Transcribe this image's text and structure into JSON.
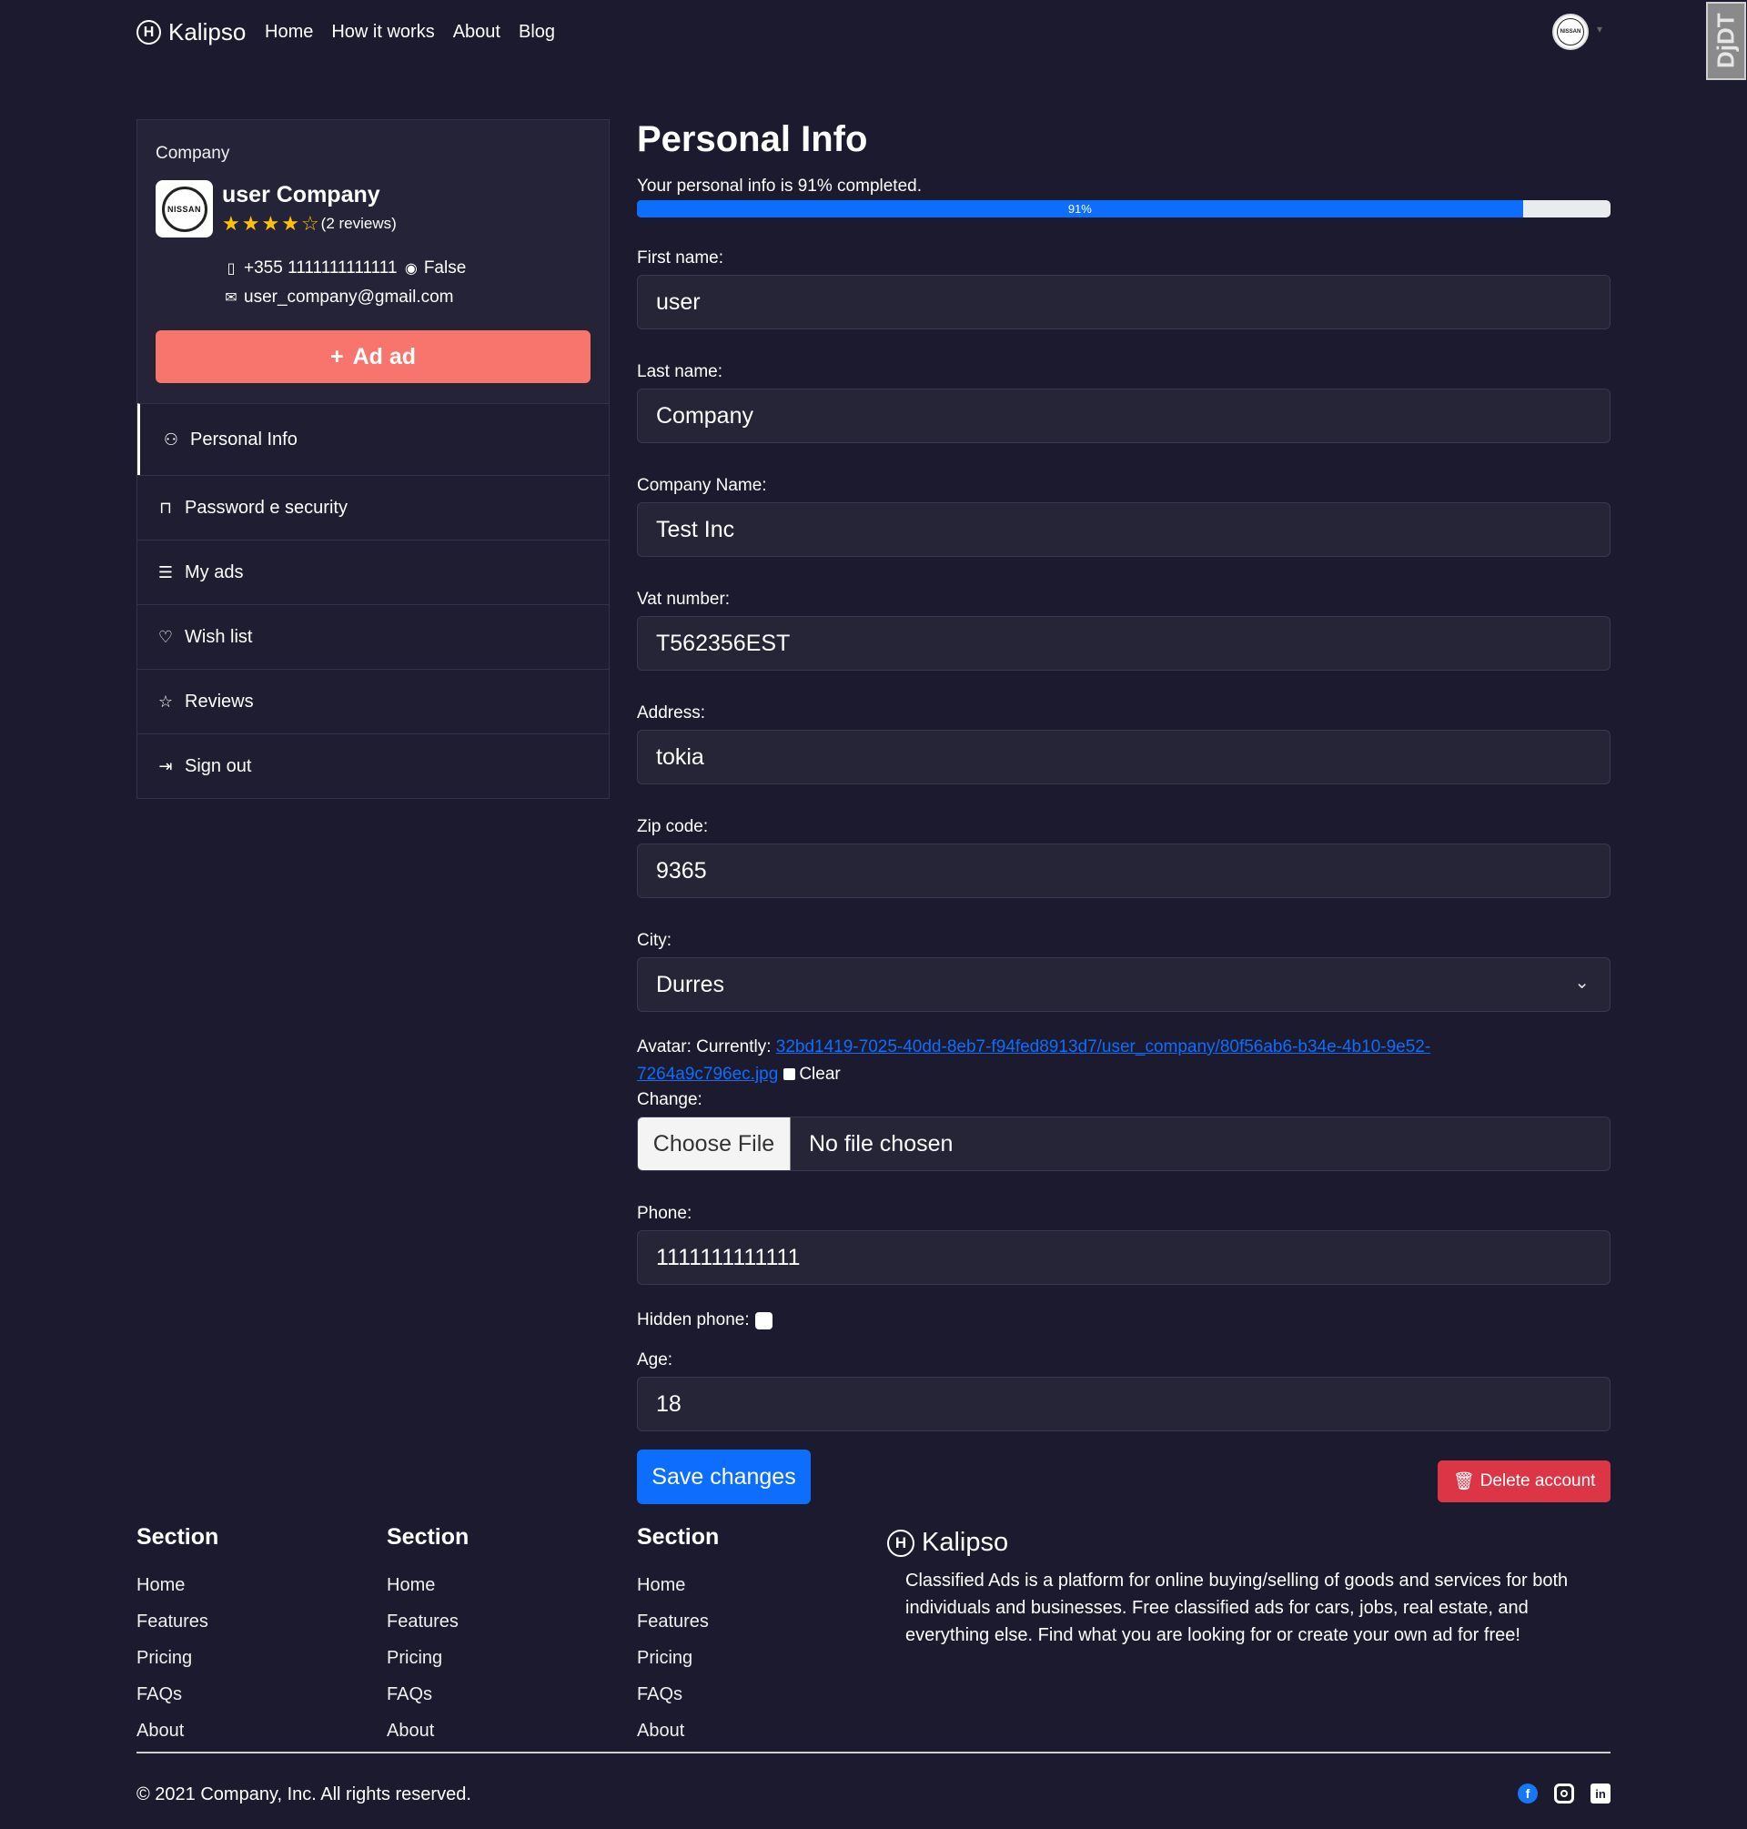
{
  "nav": {
    "brand_glyph": "H",
    "brand": "Kalipso",
    "links": [
      "Home",
      "How it works",
      "About",
      "Blog"
    ],
    "avatar_logo": "NISSAN",
    "corner_badge": "DjDT"
  },
  "sidebar": {
    "role": "Company",
    "logo_text": "NISSAN",
    "company_name": "user Company",
    "rating": 4,
    "rating_max": 5,
    "reviews": "(2 reviews)",
    "phone": "+355 1111111111111",
    "visibility": "False",
    "email": "user_company@gmail.com",
    "add_ad_label": "Ad ad",
    "menu": [
      {
        "label": "Personal Info",
        "icon": "person-icon",
        "active": true
      },
      {
        "label": "Password e security",
        "icon": "lock-icon"
      },
      {
        "label": "My ads",
        "icon": "list-icon"
      },
      {
        "label": "Wish list",
        "icon": "heart-icon"
      },
      {
        "label": "Reviews",
        "icon": "star-icon"
      },
      {
        "label": "Sign out",
        "icon": "sign-out-icon"
      }
    ]
  },
  "main": {
    "title": "Personal Info",
    "progress_text": "Your personal info is 91% completed.",
    "progress_percent": 91,
    "progress_label": "91%",
    "fields": {
      "first_name": {
        "label": "First name:",
        "value": "user"
      },
      "last_name": {
        "label": "Last name:",
        "value": "Company"
      },
      "company_name": {
        "label": "Company Name:",
        "value": "Test Inc"
      },
      "vat_number": {
        "label": "Vat number:",
        "value": "T562356EST"
      },
      "address": {
        "label": "Address:",
        "value": "tokia"
      },
      "zip_code": {
        "label": "Zip code:",
        "value": "9365"
      },
      "city": {
        "label": "City:",
        "value": "Durres"
      },
      "phone": {
        "label": "Phone:",
        "value": "1111111111111"
      },
      "age": {
        "label": "Age:",
        "value": "18"
      }
    },
    "avatar": {
      "label": "Avatar: Currently:",
      "link_part1": "32bd1419-7025-40dd-8eb7-f94fed8913d7/user_company/80f56ab6-b34e-4b10-9e52-",
      "link_part2": "7264a9c796ec.jpg",
      "clear_label": "Clear",
      "change_label": "Change:",
      "choose_file": "Choose File",
      "no_file": "No file chosen"
    },
    "hidden_phone_label": "Hidden phone:",
    "save_label": "Save changes",
    "delete_label": "Delete account"
  },
  "footer": {
    "columns": [
      {
        "title": "Section",
        "links": [
          "Home",
          "Features",
          "Pricing",
          "FAQs",
          "About"
        ]
      },
      {
        "title": "Section",
        "links": [
          "Home",
          "Features",
          "Pricing",
          "FAQs",
          "About"
        ]
      },
      {
        "title": "Section",
        "links": [
          "Home",
          "Features",
          "Pricing",
          "FAQs",
          "About"
        ]
      }
    ],
    "brand": "Kalipso",
    "description": "Classified Ads is a platform for online buying/selling of goods and services for both individuals and businesses. Free classified ads for cars, jobs, real estate, and everything else. Find what you are looking for or create your own ad for free!",
    "copyright": "© 2021 Company, Inc. All rights reserved.",
    "socials": [
      "facebook-icon",
      "instagram-icon",
      "linkedin-icon"
    ]
  }
}
